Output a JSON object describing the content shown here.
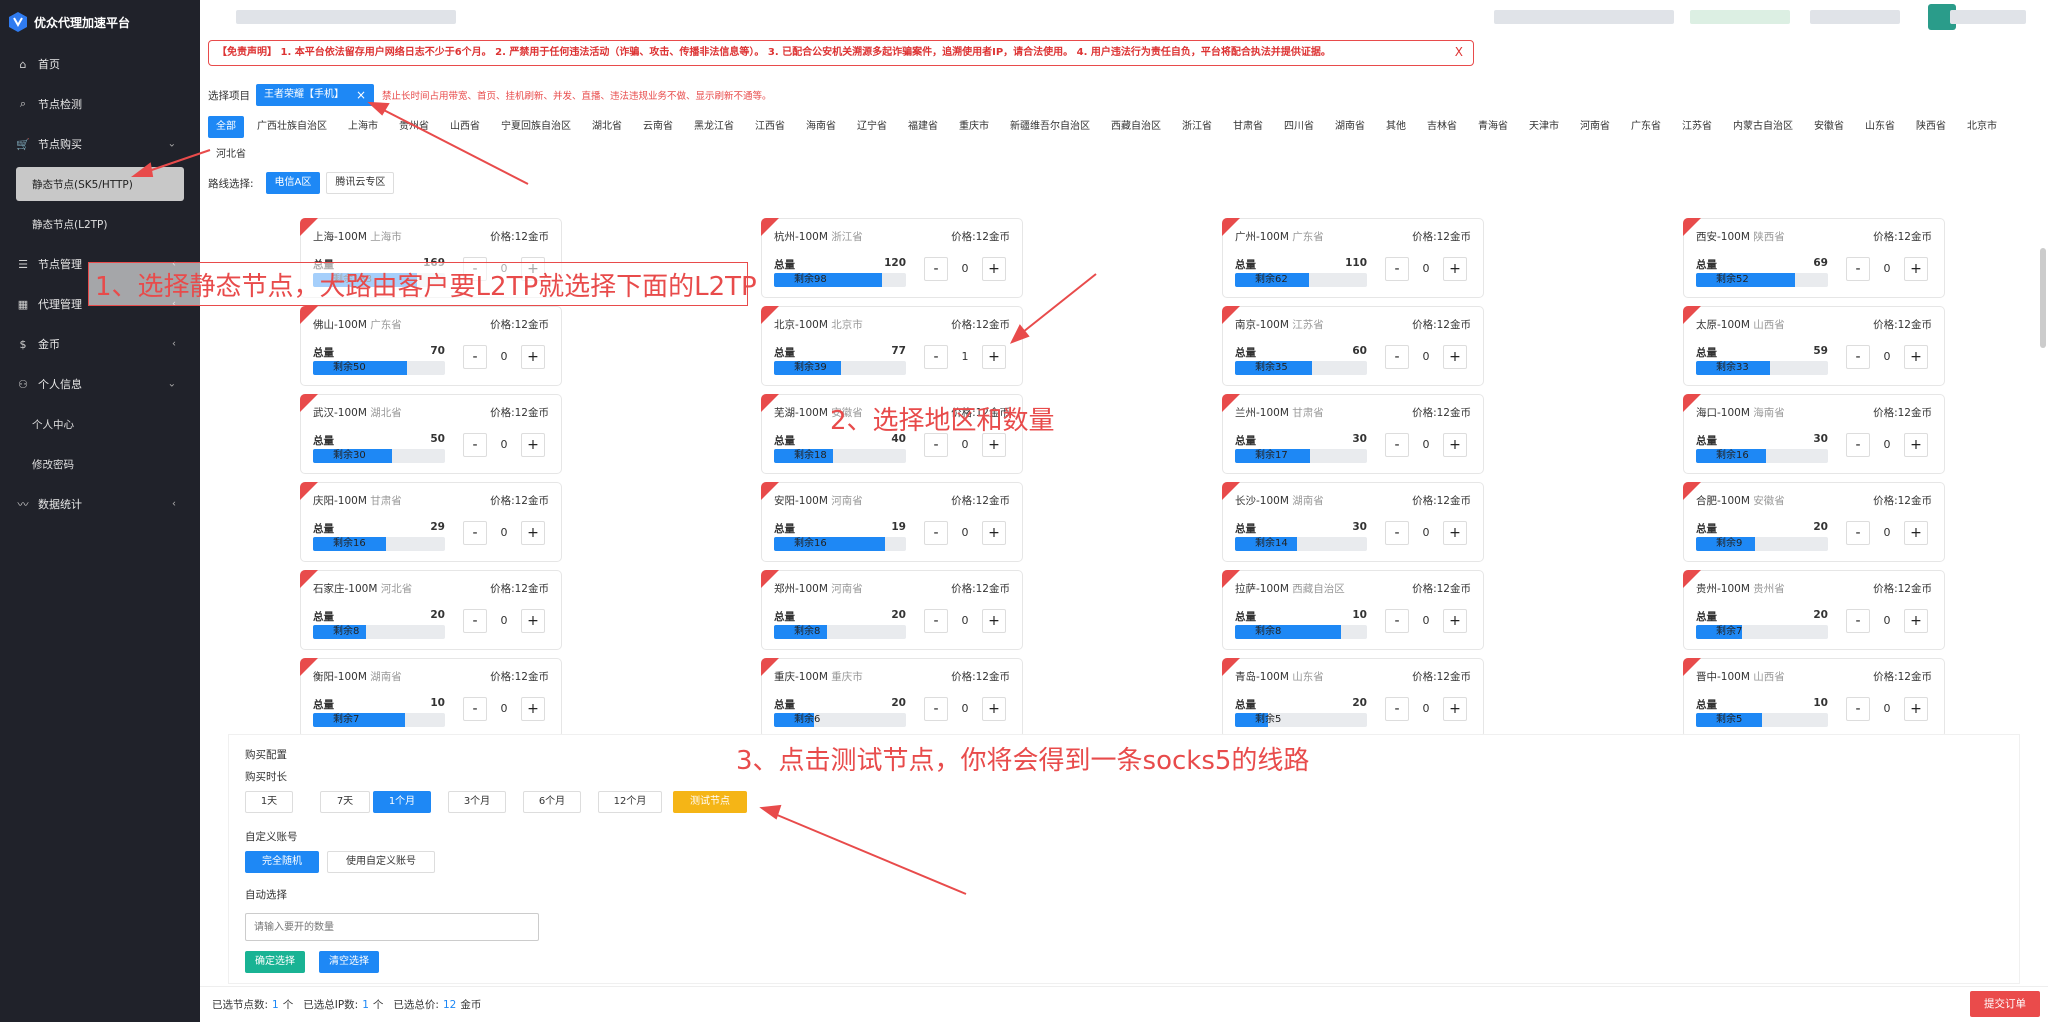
{
  "brand": {
    "title": "优众代理加速平台"
  },
  "sidebar": {
    "items": [
      {
        "icon": "home-icon",
        "glyph": "⌂",
        "label": "首页"
      },
      {
        "icon": "search-icon",
        "glyph": "⌕",
        "label": "节点检测"
      },
      {
        "icon": "cart-icon",
        "glyph": "🛒",
        "label": "节点购买",
        "chevron": "⌄"
      },
      {
        "icon": "",
        "glyph": "",
        "label": "静态节点(SK5/HTTP)",
        "sub": true,
        "active": true
      },
      {
        "icon": "",
        "glyph": "",
        "label": "静态节点(L2TP)",
        "sub": true
      },
      {
        "icon": "list-icon",
        "glyph": "☰",
        "label": "节点管理",
        "chevron": "‹"
      },
      {
        "icon": "grid-icon",
        "glyph": "▦",
        "label": "代理管理",
        "chevron": "‹"
      },
      {
        "icon": "dollar-icon",
        "glyph": "$",
        "label": "金币",
        "chevron": "‹"
      },
      {
        "icon": "user-icon",
        "glyph": "⚇",
        "label": "个人信息",
        "chevron": "⌄"
      },
      {
        "icon": "",
        "glyph": "",
        "label": "个人中心",
        "sub": true
      },
      {
        "icon": "",
        "glyph": "",
        "label": "修改密码",
        "sub": true
      },
      {
        "icon": "chart-icon",
        "glyph": "〰",
        "label": "数据统计",
        "chevron": "‹"
      }
    ]
  },
  "notice": {
    "text": "【免责声明】 1. 本平台依法留存用户网络日志不少于6个月。 2. 严禁用于任何违法活动（诈骗、攻击、传播非法信息等）。 3. 已配合公安机关溯源多起诈骗案件，追溯使用者IP，请合法使用。 4. 用户违法行为责任自负，平台将配合执法并提供证据。",
    "close": "X"
  },
  "project": {
    "label": "选择项目",
    "selected": "王者荣耀【手机】",
    "remove": "×",
    "warning": "禁止长时间占用带宽、首页、挂机刷新、并发、直播、违法违规业务不做、显示刷新不通等。"
  },
  "regions": [
    "全部",
    "广西壮族自治区",
    "上海市",
    "贵州省",
    "山西省",
    "宁夏回族自治区",
    "湖北省",
    "云南省",
    "黑龙江省",
    "江西省",
    "海南省",
    "辽宁省",
    "福建省",
    "重庆市",
    "新疆维吾尔自治区",
    "西藏自治区",
    "浙江省",
    "甘肃省",
    "四川省",
    "湖南省",
    "其他",
    "吉林省",
    "青海省",
    "天津市",
    "河南省",
    "广东省",
    "江苏省",
    "内蒙古自治区",
    "安徽省",
    "山东省",
    "陕西省",
    "北京市",
    "河北省"
  ],
  "route": {
    "label": "路线选择:",
    "options": [
      "电信A区",
      "腾讯云专区"
    ]
  },
  "nodes": [
    {
      "name": "上海-100M",
      "prov": "上海市",
      "price": "价格:12金币",
      "total_label": "总量",
      "total": "169",
      "remain": "剩余133",
      "ratio": 0.79,
      "qty": "0"
    },
    {
      "name": "杭州-100M",
      "prov": "浙江省",
      "price": "价格:12金币",
      "total_label": "总量",
      "total": "120",
      "remain": "剩余98",
      "ratio": 0.82,
      "qty": "0"
    },
    {
      "name": "广州-100M",
      "prov": "广东省",
      "price": "价格:12金币",
      "total_label": "总量",
      "total": "110",
      "remain": "剩余62",
      "ratio": 0.56,
      "qty": "0"
    },
    {
      "name": "西安-100M",
      "prov": "陕西省",
      "price": "价格:12金币",
      "total_label": "总量",
      "total": "69",
      "remain": "剩余52",
      "ratio": 0.75,
      "qty": "0"
    },
    {
      "name": "佛山-100M",
      "prov": "广东省",
      "price": "价格:12金币",
      "total_label": "总量",
      "total": "70",
      "remain": "剩余50",
      "ratio": 0.71,
      "qty": "0"
    },
    {
      "name": "北京-100M",
      "prov": "北京市",
      "price": "价格:12金币",
      "total_label": "总量",
      "total": "77",
      "remain": "剩余39",
      "ratio": 0.51,
      "qty": "1"
    },
    {
      "name": "南京-100M",
      "prov": "江苏省",
      "price": "价格:12金币",
      "total_label": "总量",
      "total": "60",
      "remain": "剩余35",
      "ratio": 0.58,
      "qty": "0"
    },
    {
      "name": "太原-100M",
      "prov": "山西省",
      "price": "价格:12金币",
      "total_label": "总量",
      "total": "59",
      "remain": "剩余33",
      "ratio": 0.56,
      "qty": "0"
    },
    {
      "name": "武汉-100M",
      "prov": "湖北省",
      "price": "价格:12金币",
      "total_label": "总量",
      "total": "50",
      "remain": "剩余30",
      "ratio": 0.6,
      "qty": "0"
    },
    {
      "name": "芜湖-100M",
      "prov": "安徽省",
      "price": "价格:12金币",
      "total_label": "总量",
      "total": "40",
      "remain": "剩余18",
      "ratio": 0.45,
      "qty": "0"
    },
    {
      "name": "兰州-100M",
      "prov": "甘肃省",
      "price": "价格:12金币",
      "total_label": "总量",
      "total": "30",
      "remain": "剩余17",
      "ratio": 0.57,
      "qty": "0"
    },
    {
      "name": "海口-100M",
      "prov": "海南省",
      "price": "价格:12金币",
      "total_label": "总量",
      "total": "30",
      "remain": "剩余16",
      "ratio": 0.53,
      "qty": "0"
    },
    {
      "name": "庆阳-100M",
      "prov": "甘肃省",
      "price": "价格:12金币",
      "total_label": "总量",
      "total": "29",
      "remain": "剩余16",
      "ratio": 0.55,
      "qty": "0"
    },
    {
      "name": "安阳-100M",
      "prov": "河南省",
      "price": "价格:12金币",
      "total_label": "总量",
      "total": "19",
      "remain": "剩余16",
      "ratio": 0.84,
      "qty": "0"
    },
    {
      "name": "长沙-100M",
      "prov": "湖南省",
      "price": "价格:12金币",
      "total_label": "总量",
      "total": "30",
      "remain": "剩余14",
      "ratio": 0.47,
      "qty": "0"
    },
    {
      "name": "合肥-100M",
      "prov": "安徽省",
      "price": "价格:12金币",
      "total_label": "总量",
      "total": "20",
      "remain": "剩余9",
      "ratio": 0.45,
      "qty": "0"
    },
    {
      "name": "石家庄-100M",
      "prov": "河北省",
      "price": "价格:12金币",
      "total_label": "总量",
      "total": "20",
      "remain": "剩余8",
      "ratio": 0.4,
      "qty": "0"
    },
    {
      "name": "郑州-100M",
      "prov": "河南省",
      "price": "价格:12金币",
      "total_label": "总量",
      "total": "20",
      "remain": "剩余8",
      "ratio": 0.4,
      "qty": "0"
    },
    {
      "name": "拉萨-100M",
      "prov": "西藏自治区",
      "price": "价格:12金币",
      "total_label": "总量",
      "total": "10",
      "remain": "剩余8",
      "ratio": 0.8,
      "qty": "0"
    },
    {
      "name": "贵州-100M",
      "prov": "贵州省",
      "price": "价格:12金币",
      "total_label": "总量",
      "total": "20",
      "remain": "剩余7",
      "ratio": 0.35,
      "qty": "0"
    },
    {
      "name": "衡阳-100M",
      "prov": "湖南省",
      "price": "价格:12金币",
      "total_label": "总量",
      "total": "10",
      "remain": "剩余7",
      "ratio": 0.7,
      "qty": "0"
    },
    {
      "name": "重庆-100M",
      "prov": "重庆市",
      "price": "价格:12金币",
      "total_label": "总量",
      "total": "20",
      "remain": "剩余6",
      "ratio": 0.3,
      "qty": "0"
    },
    {
      "name": "青岛-100M",
      "prov": "山东省",
      "price": "价格:12金币",
      "total_label": "总量",
      "total": "20",
      "remain": "剩余5",
      "ratio": 0.25,
      "qty": "0"
    },
    {
      "name": "晋中-100M",
      "prov": "山西省",
      "price": "价格:12金币",
      "total_label": "总量",
      "total": "10",
      "remain": "剩余5",
      "ratio": 0.5,
      "qty": "0"
    }
  ],
  "config": {
    "title": "购买配置",
    "duration_label": "购买时长",
    "durations": [
      "1天",
      "7天",
      "1个月",
      "3个月",
      "6个月",
      "12个月"
    ],
    "selected_duration": "1个月",
    "test_button": "测试节点",
    "account_label": "自定义账号",
    "account_options": [
      "完全随机",
      "使用自定义账号"
    ],
    "auto_label": "自动选择",
    "auto_placeholder": "请输入要开的数量",
    "confirm": "确定选择",
    "clear": "清空选择"
  },
  "footer": {
    "nodes_label": "已选节点数:",
    "nodes": "1",
    "nodes_unit": "个",
    "ip_label": "已选总IP数:",
    "ips": "1",
    "ips_unit": "个",
    "price_label": "已选总价:",
    "price": "12",
    "price_unit": "金币",
    "submit": "提交订单"
  },
  "annotations": {
    "step1": "1、选择静态节点，大路由客户要L2TP就选择下面的L2TP",
    "step2": "2、选择地区和数量",
    "step3": "3、点击测试节点，你将会得到一条socks5的线路"
  },
  "colors": {
    "accent": "#1e88f5",
    "danger": "#e84b4b",
    "warning": "#f5b516",
    "success": "#19b394",
    "sidebar": "#20222a"
  }
}
